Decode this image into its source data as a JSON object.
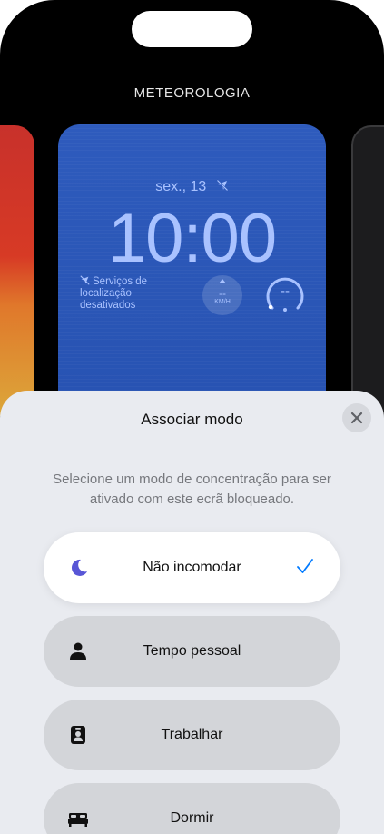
{
  "gallery": {
    "title": "METEOROLOGIA"
  },
  "lockscreen": {
    "date": "sex., 13",
    "time": "10:00",
    "location_widget": "Serviços de localização desativados",
    "wind_value": "--",
    "wind_unit": "KM/H",
    "gauge_value": "--"
  },
  "sheet": {
    "title": "Associar modo",
    "description": "Selecione um modo de concentração para ser ativado com este ecrã bloqueado.",
    "close_icon": "close-icon",
    "modes": [
      {
        "label": "Não incomodar",
        "icon": "moon-icon",
        "selected": true,
        "color": "#5856d6"
      },
      {
        "label": "Tempo pessoal",
        "icon": "person-icon",
        "selected": false
      },
      {
        "label": "Trabalhar",
        "icon": "badge-icon",
        "selected": false
      },
      {
        "label": "Dormir",
        "icon": "bed-icon",
        "selected": false
      }
    ]
  },
  "colors": {
    "accent": "#007aff",
    "wallpaper": "#2a56b6",
    "widget_text": "#a9c2ff"
  }
}
